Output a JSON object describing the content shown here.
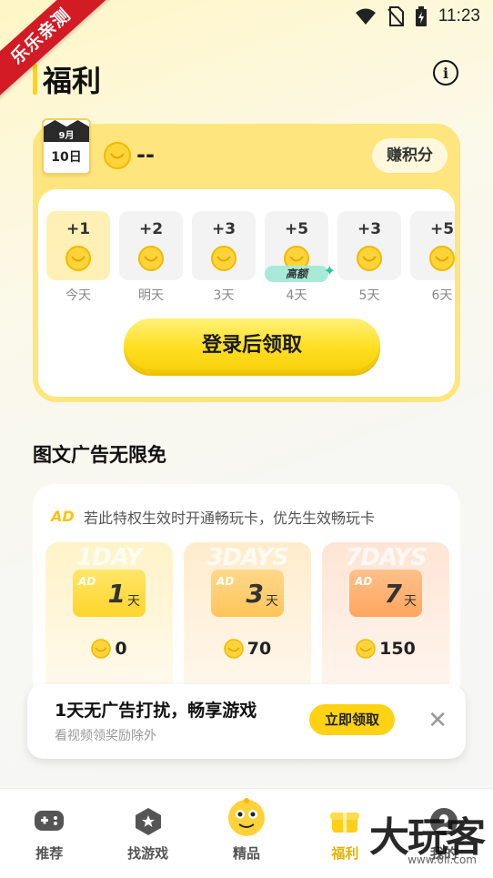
{
  "ribbon": "乐乐亲测",
  "status_bar": {
    "time": "11:23"
  },
  "header": {
    "title": "福利"
  },
  "checkin": {
    "calendar": {
      "month": "9月",
      "day": "10日"
    },
    "points": "--",
    "earn_button": "赚积分",
    "days": [
      {
        "plus": "+1",
        "label": "今天"
      },
      {
        "plus": "+2",
        "label": "明天"
      },
      {
        "plus": "+3",
        "label": "3天"
      },
      {
        "plus": "+5",
        "label": "4天",
        "tag": "高额"
      },
      {
        "plus": "+3",
        "label": "5天"
      },
      {
        "plus": "+5",
        "label": "6天"
      }
    ],
    "claim_button": "登录后领取"
  },
  "ad_section": {
    "title": "图文广告无限免",
    "badge": "AD",
    "note": "若此特权生效时开通畅玩卡，优先生效畅玩卡",
    "plans": [
      {
        "watermark": "1DAY",
        "ticket_badge": "AD",
        "num": "1",
        "unit": "天",
        "price": "0"
      },
      {
        "watermark": "3DAYS",
        "ticket_badge": "AD",
        "num": "3",
        "unit": "天",
        "price": "70"
      },
      {
        "watermark": "7DAYS",
        "ticket_badge": "AD",
        "num": "7",
        "unit": "天",
        "price": "150"
      }
    ]
  },
  "promo": {
    "title": "1天无广告打扰，畅享游戏",
    "subtitle": "看视频领奖励除外",
    "claim_button": "立即领取"
  },
  "nav": {
    "items": [
      {
        "label": "推荐",
        "icon": "gamepad-icon"
      },
      {
        "label": "找游戏",
        "icon": "hexagon-star-icon"
      },
      {
        "label": "精品",
        "icon": "mascot-icon"
      },
      {
        "label": "福利",
        "icon": "gift-icon"
      },
      {
        "label": "我的",
        "icon": "profile-icon"
      }
    ]
  },
  "watermark": {
    "logo": "大玩客",
    "url": "www.6ll.com"
  },
  "colors": {
    "accent": "#ffd313",
    "card": "#ffe57d"
  }
}
